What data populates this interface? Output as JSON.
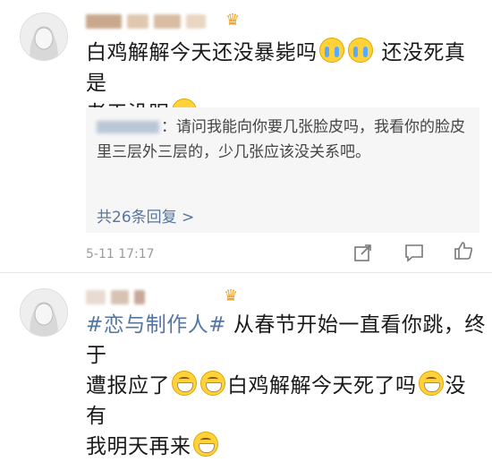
{
  "comment1": {
    "text_a": "白鸡解解今天还没暴毙吗",
    "text_b": "还没死真是",
    "text_c": "老天没眼",
    "reply": {
      "text": "：请问我能向你要几张脸皮吗，我看你的脸皮里三层外三层的，少几张应该没关系吧。",
      "more_label": "共26条回复 >"
    },
    "timestamp": "5-11 17:17"
  },
  "comment2": {
    "hashtag": "#恋与制作人#",
    "text_a": " 从春节开始一直看你跳，终于",
    "text_b": "遭报应了",
    "text_c": "白鸡解解今天死了吗",
    "text_d": "没有",
    "text_e": "我明天再来"
  },
  "icons": {
    "share": "share-icon",
    "comment": "comment-icon",
    "like": "thumbs-up-icon",
    "crown": "crown-icon"
  },
  "colors": {
    "link": "#5576a0",
    "meta": "#9a9a9a"
  }
}
